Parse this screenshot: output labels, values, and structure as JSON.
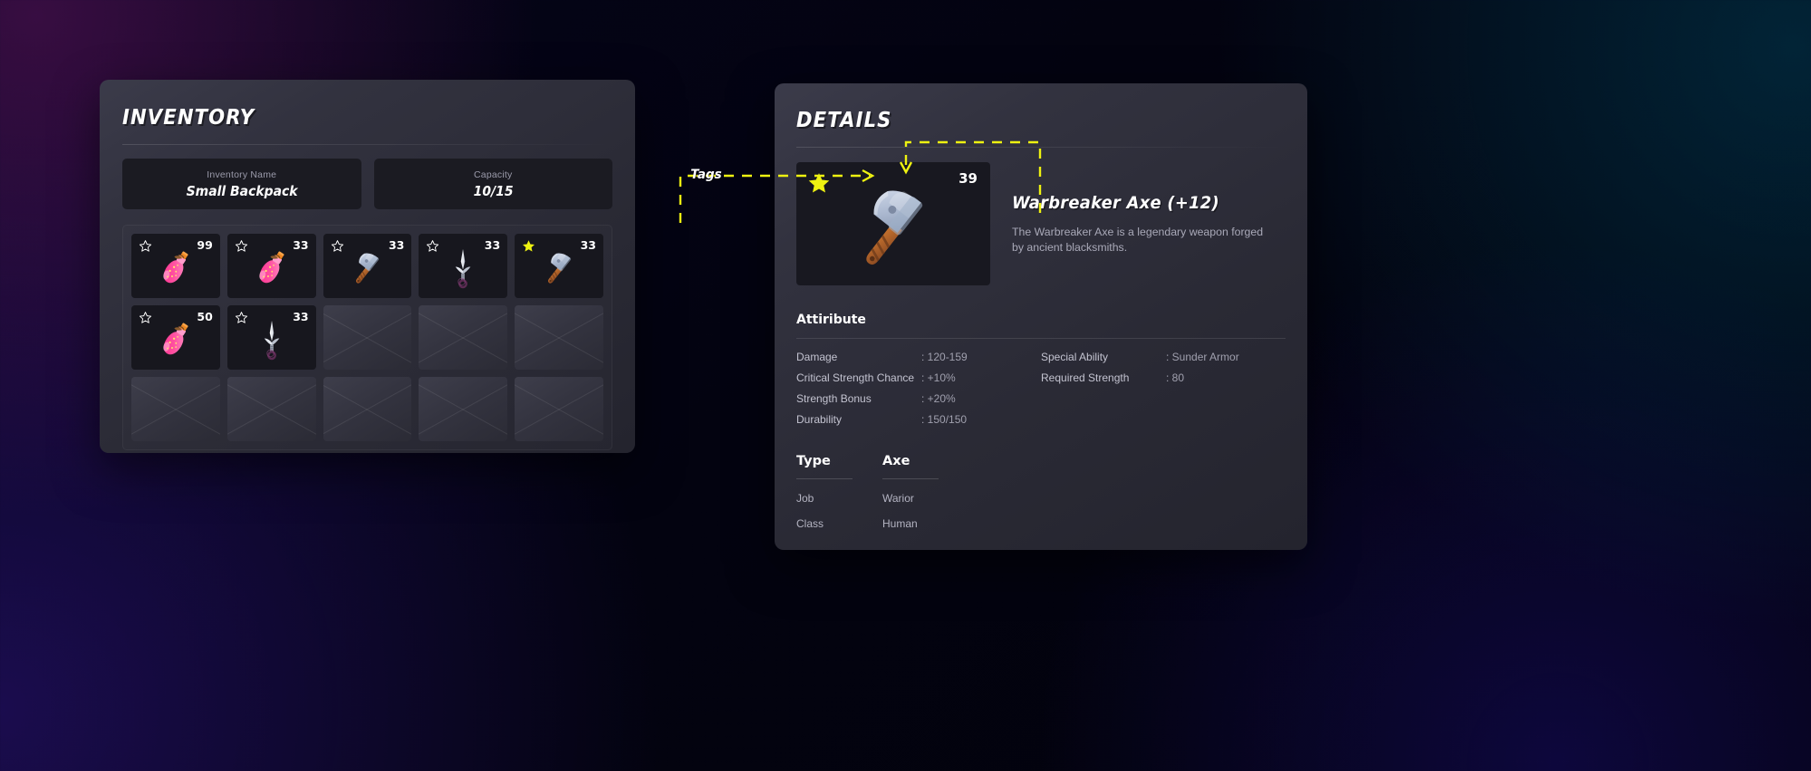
{
  "inventory": {
    "title": "INVENTORY",
    "meta": [
      {
        "label": "Inventory Name",
        "value": "Small Backpack"
      },
      {
        "label": "Capacity",
        "value": "10/15"
      }
    ],
    "slots": [
      {
        "icon": "potion-icon",
        "count": "99",
        "starred": false,
        "empty": false
      },
      {
        "icon": "potion-icon",
        "count": "33",
        "starred": false,
        "empty": false
      },
      {
        "icon": "axe-icon",
        "count": "33",
        "starred": false,
        "empty": false
      },
      {
        "icon": "dagger-icon",
        "count": "33",
        "starred": false,
        "empty": false
      },
      {
        "icon": "axe-icon",
        "count": "33",
        "starred": true,
        "empty": false
      },
      {
        "icon": "potion-icon",
        "count": "50",
        "starred": false,
        "empty": false
      },
      {
        "icon": "dagger-icon",
        "count": "33",
        "starred": false,
        "empty": false
      },
      {
        "icon": "",
        "count": "",
        "starred": false,
        "empty": true
      },
      {
        "icon": "",
        "count": "",
        "starred": false,
        "empty": true
      },
      {
        "icon": "",
        "count": "",
        "starred": false,
        "empty": true
      },
      {
        "icon": "",
        "count": "",
        "starred": false,
        "empty": true
      },
      {
        "icon": "",
        "count": "",
        "starred": false,
        "empty": true
      },
      {
        "icon": "",
        "count": "",
        "starred": false,
        "empty": true
      },
      {
        "icon": "",
        "count": "",
        "starred": false,
        "empty": true
      },
      {
        "icon": "",
        "count": "",
        "starred": false,
        "empty": true
      }
    ]
  },
  "details": {
    "title": "DETAILS",
    "item": {
      "icon": "axe-icon",
      "count": "39",
      "starred": true,
      "name": "Warbreaker Axe (+12)",
      "description": "The Warbreaker Axe is a legendary weapon forged by ancient blacksmiths."
    },
    "attributes": {
      "heading": "Attiribute",
      "left": [
        {
          "key": "Damage",
          "value": ": 120-159"
        },
        {
          "key": "Critical Strength Chance",
          "value": ": +10%"
        },
        {
          "key": "Strength Bonus",
          "value": ": +20%"
        },
        {
          "key": "Durability",
          "value": ": 150/150"
        }
      ],
      "right": [
        {
          "key": "Special Ability",
          "value": ": Sunder Armor"
        },
        {
          "key": "Required Strength",
          "value": ": 80"
        }
      ]
    },
    "type_table": {
      "header": {
        "col1": "Type",
        "col2": "Axe"
      },
      "rows": [
        {
          "key": "Job",
          "value": "Warior"
        },
        {
          "key": "Class",
          "value": "Human"
        }
      ]
    }
  },
  "annotation": {
    "tags_label": "Tags",
    "color": "#eef211"
  }
}
